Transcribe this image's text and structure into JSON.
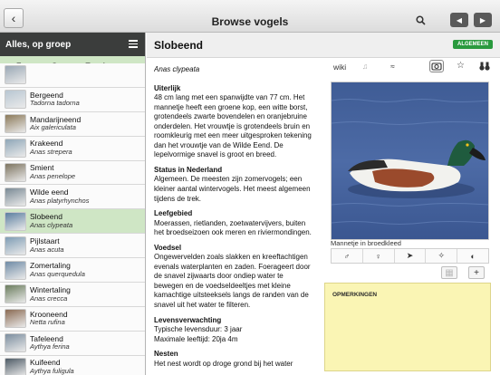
{
  "header": {
    "title": "Browse vogels",
    "back_icon": "chevron-left-icon",
    "search_icon": "search-icon",
    "prev_icon": "triangle-left-icon",
    "next_icon": "triangle-right-icon"
  },
  "sidebar": {
    "title": "Alles, op groep",
    "menu_icon": "hamburger-menu-icon",
    "group": {
      "label": "Zwanen, Ganzen, Eenden",
      "expanded": true
    },
    "items": [
      {
        "name": "",
        "latin": "",
        "thumb": "#9aa8b5"
      },
      {
        "name": "Bergeend",
        "latin": "Tadorna tadorna",
        "thumb": "#b8c6d2"
      },
      {
        "name": "Mandarijneend",
        "latin": "Aix galericulata",
        "thumb": "#8c7a5a"
      },
      {
        "name": "Krakeend",
        "latin": "Anas strepera",
        "thumb": "#8fa7b8"
      },
      {
        "name": "Smient",
        "latin": "Anas penelope",
        "thumb": "#7d7460"
      },
      {
        "name": "Wilde eend",
        "latin": "Anas platyrhynchos",
        "thumb": "#7a8a95"
      },
      {
        "name": "Slobeend",
        "latin": "Anas clypeata",
        "thumb": "#5b7ea0",
        "active": true
      },
      {
        "name": "Pijlstaart",
        "latin": "Anas acuta",
        "thumb": "#7f9db5"
      },
      {
        "name": "Zomertaling",
        "latin": "Anas querquedula",
        "thumb": "#6f8ba6"
      },
      {
        "name": "Wintertaling",
        "latin": "Anas crecca",
        "thumb": "#6b7d5e"
      },
      {
        "name": "Krooneend",
        "latin": "Netta rufina",
        "thumb": "#8a6a52"
      },
      {
        "name": "Tafeleend",
        "latin": "Aythya ferina",
        "thumb": "#7c8e9f"
      },
      {
        "name": "Kuifeend",
        "latin": "Aythya fuligula",
        "thumb": "#4e5b66"
      }
    ]
  },
  "detail": {
    "title": "Slobeend",
    "badge": "ALGEMEEN",
    "badge_color": "#2a9a3e",
    "latin": "Anas clypeata",
    "sections": [
      {
        "heading": "Uiterlijk",
        "text": "48 cm lang met een spanwijdte van 77 cm. Het mannetje heeft een groene kop, een witte borst, grotendeels zwarte bovendelen en oranjebruine onderdelen. Het vrouwtje is grotendeels bruin en roomkleurig met een meer uitgesproken tekening dan het vrouwtje van de Wilde Eend. De lepelvormige snavel is groot en breed."
      },
      {
        "heading": "Status in Nederland",
        "text": "Algemeen. De meesten zijn zomervogels; een kleiner aantal wintervogels. Het meest algemeen tijdens de trek."
      },
      {
        "heading": "Leefgebied",
        "text": "Moerassen, rietlanden, zoetwatervijvers, buiten het broedseizoen ook meren en riviermondingen."
      },
      {
        "heading": "Voedsel",
        "text": "Ongewervelden zoals slakken en kreeftachtigen evenals waterplanten en zaden. Foerageert door de snavel zijwaarts door ondiep water te bewegen en de voedseldeeltjes met kleine kamachtige uitsteeksels langs de randen van de snavel uit het water te filteren."
      },
      {
        "heading": "Levensverwachting",
        "text": "Typische levensduur: 3 jaar\nMaximale leeftijd: 20ja 4m"
      },
      {
        "heading": "Nesten",
        "text": "Het nest wordt op droge grond bij het water"
      }
    ],
    "tools": {
      "wiki": "wiki",
      "music_icon": "music-note-icon",
      "sonogram_icon": "sonogram-icon",
      "camera_icon": "camera-icon",
      "star_icon": "star-icon",
      "binoculars_icon": "binoculars-icon"
    },
    "photo_caption": "Mannetje in broedkleed",
    "photo_icons": [
      "male-icon",
      "female-icon",
      "perched-bird-icon",
      "flying-bird-icon",
      "globe-icon"
    ],
    "notes_title": "OPMERKINGEN"
  }
}
